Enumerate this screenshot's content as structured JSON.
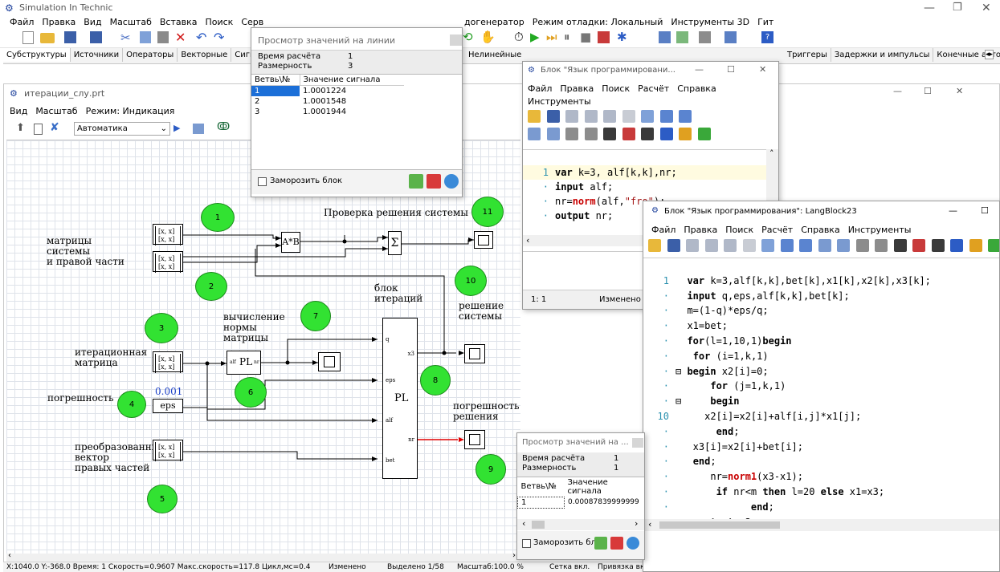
{
  "app": {
    "title": "Simulation In Technic",
    "menu": [
      "Файл",
      "Правка",
      "Вид",
      "Масштаб",
      "Вставка",
      "Поиск",
      "Серв"
    ],
    "menu_right": [
      "догенератор",
      "Режим отладки: Локальный",
      "Инструменты 3D",
      "Гит"
    ],
    "tabs": [
      "Субструктуры",
      "Источники",
      "Операторы",
      "Векторные",
      "Сигнал"
    ],
    "tabs_mid": [
      "Нелинейные"
    ],
    "tabs_right": [
      "Триггеры",
      "Задержки и импульсы",
      "Конечные авто"
    ]
  },
  "doc": {
    "title": "итерации_слу.prt",
    "menu": [
      "Вид",
      "Масштаб",
      "Режим: Индикация"
    ],
    "mode_select": "Автоматика"
  },
  "diagram": {
    "labels": {
      "matrices": "матрицы\nсистемы\nи правой части",
      "check": "Проверка решения системы",
      "norm": "вычисление\nнормы\nматрицы",
      "iter_block": "блок\nитераций",
      "solution": "решение\nсистемы",
      "iter_matrix": "итерационная\nматрица",
      "error": "погрешность",
      "eps_value": "0.001",
      "err_solution": "погрешность\nрешения",
      "transformed": "преобразованный\nвектор\nправых частей"
    },
    "blocks": {
      "matrix": "[x, x]\n[x, x]",
      "axb": "A*B",
      "sum": "Σ",
      "pl": "PL",
      "pl_small": "PL",
      "eps": "eps",
      "port_q": "q",
      "port_x3": "x3",
      "port_eps": "eps",
      "port_alf": "alf",
      "port_nr": "nr",
      "port_bet": "bet",
      "port_alf_small": "alf",
      "port_nr_small": "nr"
    },
    "nodes": [
      "1",
      "2",
      "3",
      "4",
      "5",
      "6",
      "7",
      "8",
      "9",
      "10",
      "11"
    ]
  },
  "status": {
    "coords": "X:1040.0  Y:-368.0 Время: 1 Скорость=0.9607 Макс.скорость=117.8 Цикл,мс=0.4",
    "changed": "Изменено",
    "selected": "Выделено 1/58",
    "scale": "Масштаб:100.0 %",
    "grid": "Сетка вкл.",
    "snap": "Привязка вкл."
  },
  "viewer1": {
    "title": "Просмотр значений на линии",
    "calc_time_label": "Время расчёта",
    "calc_time": "1",
    "dim_label": "Размерность",
    "dim": "3",
    "col_branch": "Ветвь\\№",
    "col_value": "Значение сигнала",
    "rows": [
      {
        "b": "1",
        "v": "1.0001224"
      },
      {
        "b": "2",
        "v": "1.0001548"
      },
      {
        "b": "3",
        "v": "1.0001944"
      }
    ],
    "freeze": "Заморозить блок"
  },
  "viewer2": {
    "title": "Просмотр значений на ...",
    "calc_time_label": "Время расчёта",
    "calc_time": "1",
    "dim_label": "Размерность",
    "dim": "1",
    "col_branch": "Ветвь\\№",
    "col_value": "Значение сигнала",
    "rows": [
      {
        "b": "1",
        "v": "0.00087839999999"
      }
    ],
    "freeze": "Заморозить блок"
  },
  "lang1": {
    "title": "Блок \"Язык программировани...",
    "menu": [
      "Файл",
      "Правка",
      "Поиск",
      "Расчёт",
      "Справка"
    ],
    "menu2": [
      "Инструменты"
    ],
    "status_pos": "1: 1",
    "status_changed": "Изменено"
  },
  "lang2": {
    "title": "Блок \"Язык программирования\": LangBlock23",
    "menu": [
      "Файл",
      "Правка",
      "Поиск",
      "Расчёт",
      "Справка",
      "Инструменты"
    ]
  },
  "colors": {
    "node": "#32e232",
    "red_line": "#e00000",
    "grid": "#dfe3ea"
  }
}
